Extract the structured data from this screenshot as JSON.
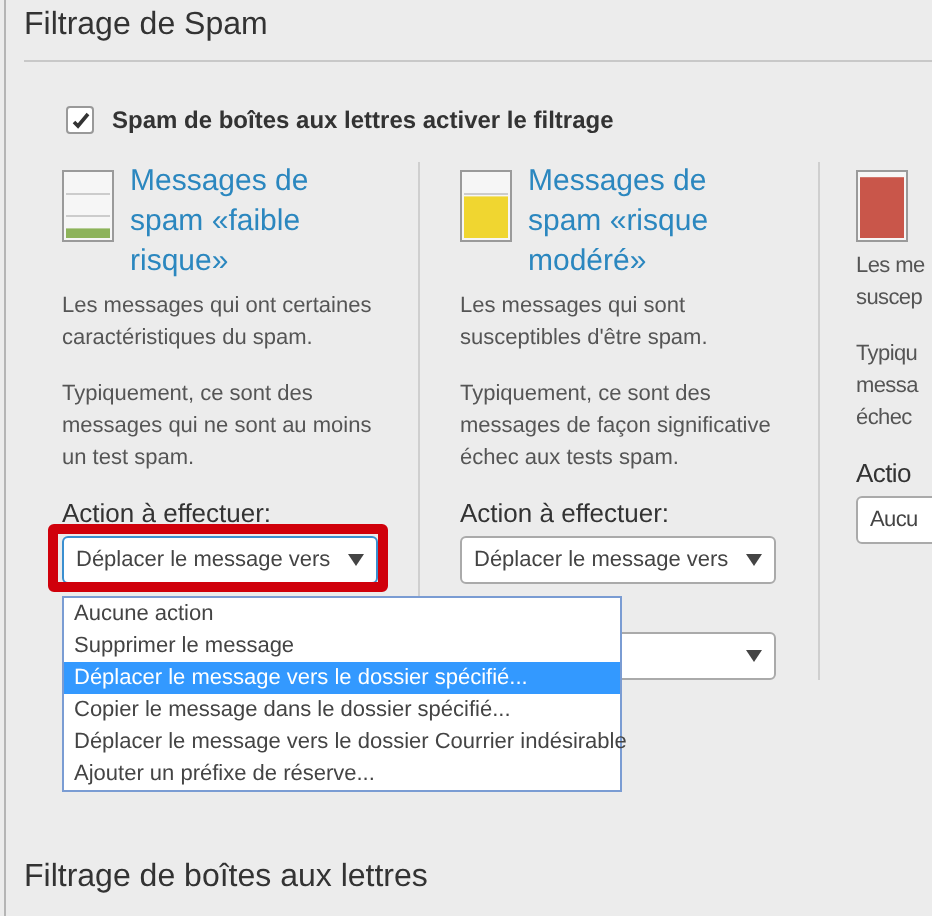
{
  "section_title": "Filtrage de Spam",
  "enable_filter": {
    "label": "Spam de boîtes aux lettres activer le filtrage",
    "checked": true
  },
  "columns": [
    {
      "level": 0.15,
      "color": "#8db35a",
      "title": "Messages de spam «faible risque»",
      "paragraphs": [
        "Les messages qui ont certaines caractéristiques du spam.",
        "Typiquement, ce sont des messages qui ne sont au moins un test spam."
      ],
      "action_label": "Action à effectuer:",
      "action": {
        "value": "Déplacer le message vers",
        "highlighted": true,
        "open": true,
        "options": [
          {
            "label": "Aucune action",
            "selected": false
          },
          {
            "label": "Supprimer le message",
            "selected": false
          },
          {
            "label": "Déplacer le message vers le dossier spécifié...",
            "selected": true
          },
          {
            "label": "Copier le message dans le dossier spécifié...",
            "selected": false
          },
          {
            "label": "Déplacer le message vers le dossier Courrier indésirable",
            "selected": false
          },
          {
            "label": "Ajouter un préfixe de réserve...",
            "selected": false
          }
        ]
      }
    },
    {
      "level": 0.65,
      "color": "#f0d630",
      "title": "Messages de spam «risque modéré»",
      "paragraphs": [
        "Les messages qui sont susceptibles d'être spam.",
        "Typiquement, ce sont des messages de façon significative échec aux tests spam."
      ],
      "action_label": "Action à effectuer:",
      "action": {
        "value": "Déplacer le message vers",
        "open": false
      },
      "folder_select": true
    },
    {
      "level": 0.95,
      "color": "#c9564a",
      "paragraphs": [
        "Les me\nsuscep",
        "Typiqu\nmessa\néchec"
      ],
      "action_label": "Actio",
      "action": {
        "value": "Aucu",
        "open": false
      }
    }
  ],
  "next_section_title": "Filtrage de boîtes aux lettres"
}
